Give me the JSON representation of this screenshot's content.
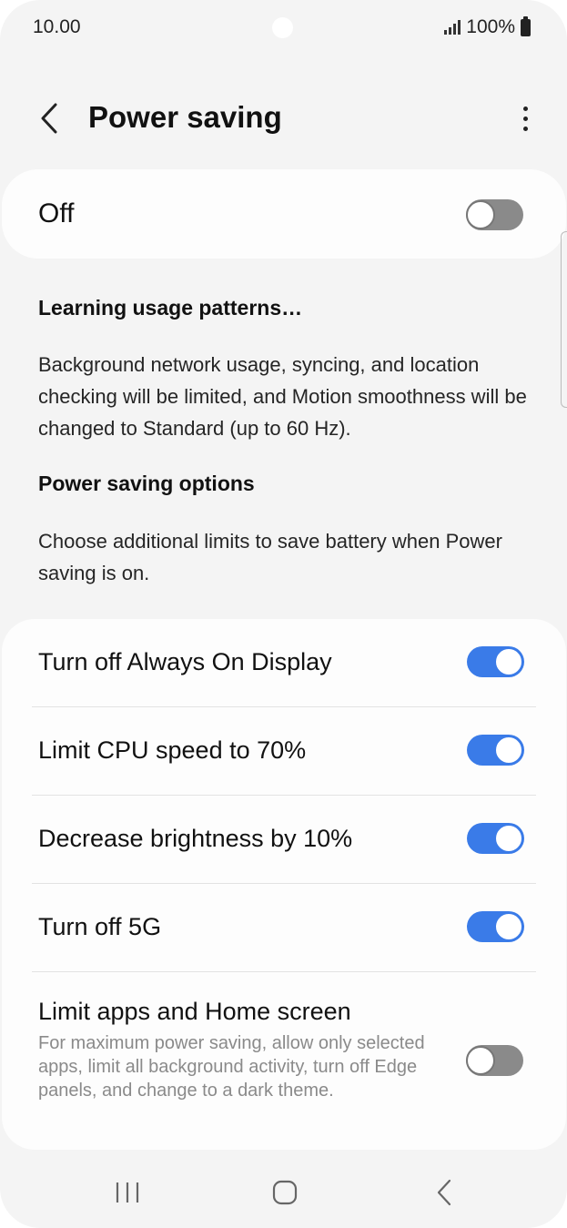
{
  "status": {
    "time": "10.00",
    "battery": "100%"
  },
  "header": {
    "title": "Power saving"
  },
  "master": {
    "label": "Off",
    "enabled": false
  },
  "info": {
    "learning_heading": "Learning usage patterns…",
    "learning_body": "Background network usage, syncing, and location checking will be limited, and Motion smoothness will be changed to Standard (up to 60 Hz).",
    "options_heading": "Power saving options",
    "options_body": "Choose additional limits to save battery when Power saving is on."
  },
  "options": [
    {
      "label": "Turn off Always On Display",
      "enabled": true
    },
    {
      "label": "Limit CPU speed to 70%",
      "enabled": true
    },
    {
      "label": "Decrease brightness by 10%",
      "enabled": true
    },
    {
      "label": "Turn off 5G",
      "enabled": true
    },
    {
      "label": "Limit apps and Home screen",
      "description": "For maximum power saving, allow only selected apps, limit all background activity, turn off Edge panels, and change to a dark theme.",
      "enabled": false
    }
  ],
  "colors": {
    "accent": "#3a7be8",
    "toggle_off": "#8a8a8a",
    "background": "#f4f4f4",
    "card": "#fdfdfd"
  },
  "icons": {
    "back": "chevron-left-icon",
    "more": "more-vert-icon",
    "nav_recents": "recents-icon",
    "nav_home": "home-icon",
    "nav_back": "back-icon"
  }
}
